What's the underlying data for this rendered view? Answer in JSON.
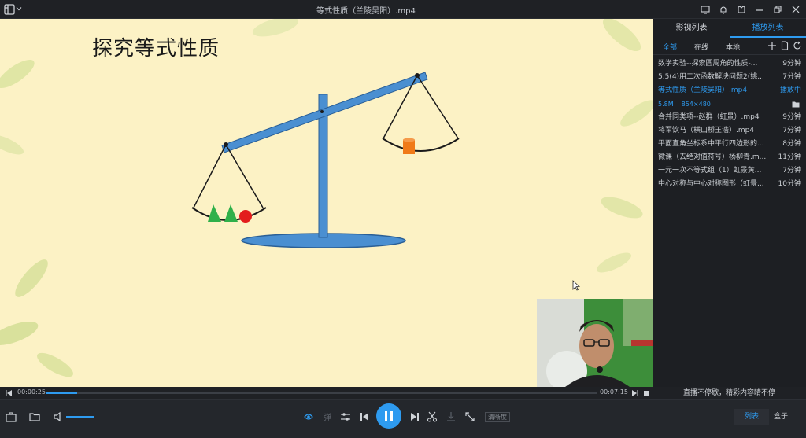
{
  "window": {
    "title": "等式性质（兰陵吴阳）.mp4"
  },
  "video": {
    "slide_title": "探究等式性质"
  },
  "sidebar": {
    "tabs": [
      {
        "label": "影视列表",
        "active": false
      },
      {
        "label": "播放列表",
        "active": true
      }
    ],
    "filters": [
      {
        "label": "全部",
        "active": true
      },
      {
        "label": "在线",
        "active": false
      },
      {
        "label": "本地",
        "active": false
      }
    ],
    "playlist": [
      {
        "name": "数学实验--探索圆周角的性质-...",
        "duration": "9分钟"
      },
      {
        "name": "5.5(4)用二次函数解决问题2(姚...",
        "duration": "7分钟"
      },
      {
        "name": "等式性质（兰陵吴阳）.mp4",
        "duration": "播放中",
        "playing": true
      },
      {
        "name": "合并同类项--赵群（虹景）.mp4",
        "duration": "9分钟"
      },
      {
        "name": "将军饮马（横山桥王浩）.mp4",
        "duration": "7分钟"
      },
      {
        "name": "平面直角坐标系中平行四边形的...",
        "duration": "8分钟"
      },
      {
        "name": "微课（去绝对值符号）杨柳青.m...",
        "duration": "11分钟"
      },
      {
        "name": "一元一次不等式组（1）虹景黄...",
        "duration": "7分钟"
      },
      {
        "name": "中心对称与中心对称图形（虹景...",
        "duration": "10分钟"
      }
    ],
    "now_playing_meta": {
      "size": "5.8M",
      "resolution": "854×480"
    },
    "slogan": "直播不停歇，精彩内容睛不停"
  },
  "progress": {
    "current_time": "00:00:25",
    "total_time": "00:07:15",
    "fraction": 0.057
  },
  "controls": {
    "quality_label": "清晰度",
    "segments": [
      {
        "label": "列表",
        "active": true
      },
      {
        "label": "盒子",
        "active": false
      }
    ],
    "volume": 0.8
  },
  "colors": {
    "accent": "#2e9bf0",
    "video_bg": "#fcf2c5",
    "app_bg": "#1b1d21"
  }
}
